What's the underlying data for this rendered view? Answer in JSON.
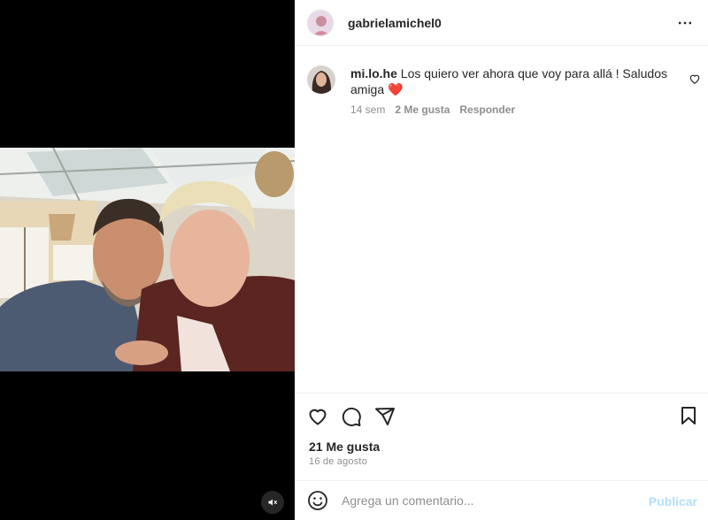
{
  "post": {
    "author": "gabrielamichel0",
    "more_icon": "more-horizontal-icon"
  },
  "comment": {
    "username": "mi.lo.he",
    "text": "Los quiero ver ahora que voy para allá ! Saludos amiga",
    "emoji": "❤️",
    "time": "14 sem",
    "likes": "2 Me gusta",
    "reply": "Responder"
  },
  "actions": {
    "icons": [
      "heart-icon",
      "comment-icon",
      "share-icon",
      "bookmark-icon"
    ]
  },
  "likes_count": "21 Me gusta",
  "date": "16 de agosto",
  "add_comment": {
    "placeholder": "Agrega un comentario...",
    "publish": "Publicar"
  },
  "media": {
    "mute_icon": "speaker-muted-icon"
  },
  "colors": {
    "text": "#262626",
    "secondary": "#8e8e8e",
    "publish_disabled": "#b2dffc",
    "heart_red": "#ed4956"
  }
}
